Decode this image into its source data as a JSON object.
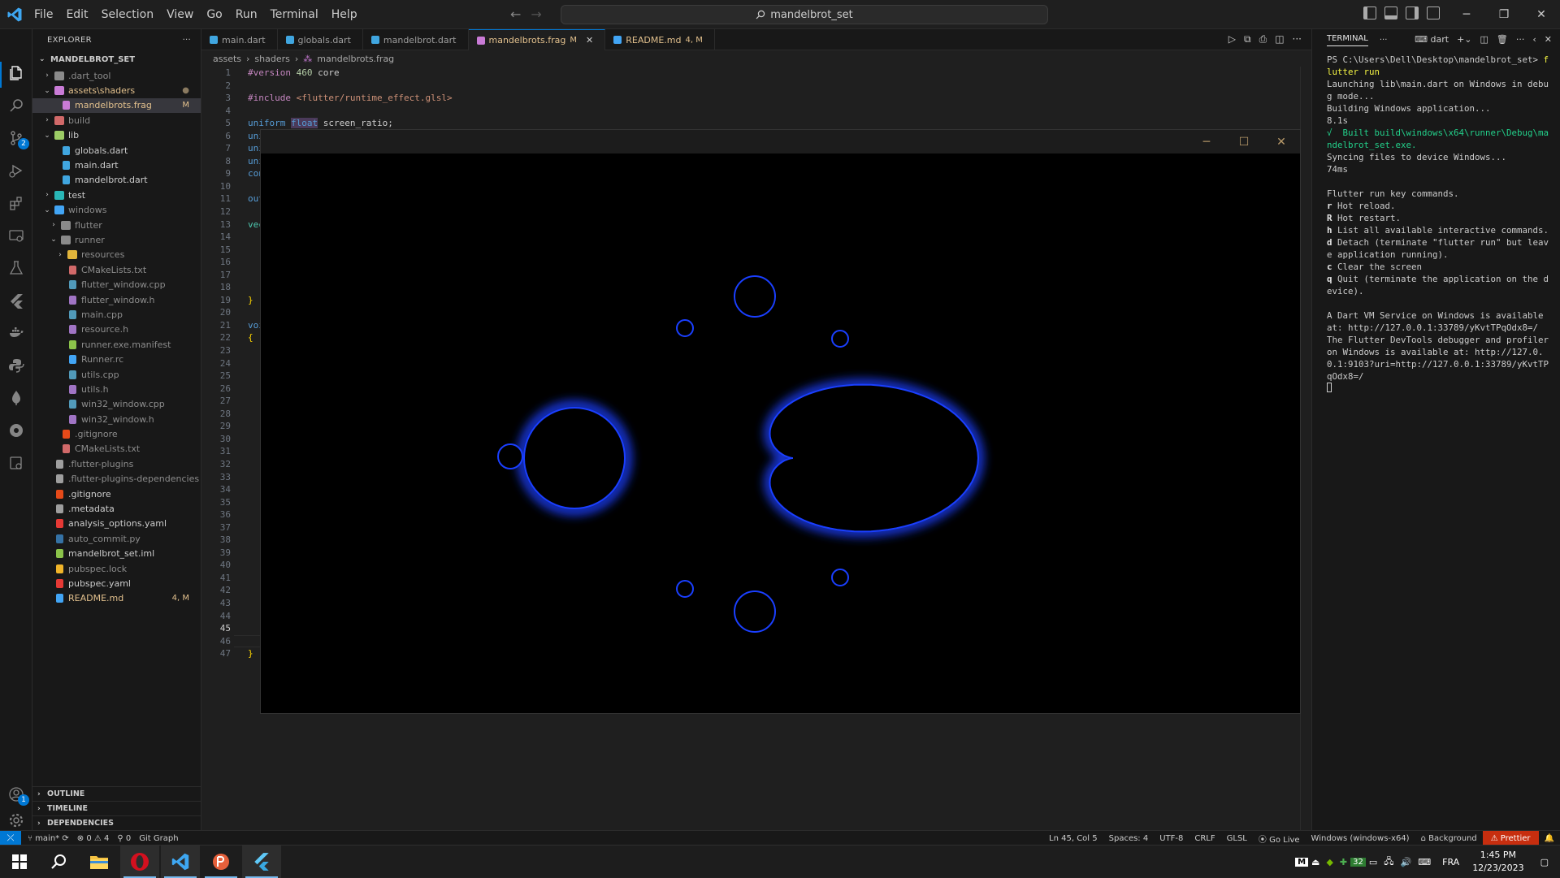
{
  "titlebar": {
    "menu": [
      "File",
      "Edit",
      "Selection",
      "View",
      "Go",
      "Run",
      "Terminal",
      "Help"
    ],
    "search": "mandelbrot_set"
  },
  "explorer": {
    "header": "EXPLORER",
    "root": "MANDELBROT_SET",
    "tree": [
      {
        "indent": 0,
        "chev": "›",
        "icon": "folder",
        "color": "#8a8a8a",
        "name": ".dart_tool",
        "status": "",
        "nameColor": "#8c8c8c"
      },
      {
        "indent": 0,
        "chev": "⌄",
        "icon": "folder",
        "color": "#c97bd6",
        "name": "assets\\shaders",
        "status": "●",
        "nameColor": "#e2c08d"
      },
      {
        "indent": 1,
        "chev": "",
        "icon": "shader",
        "color": "#c97bd6",
        "name": "mandelbrots.frag",
        "status": "M",
        "nameColor": "#e2c08d",
        "selected": true
      },
      {
        "indent": 0,
        "chev": "›",
        "icon": "folder",
        "color": "#d16969",
        "name": "build",
        "status": "",
        "nameColor": "#8c8c8c"
      },
      {
        "indent": 0,
        "chev": "⌄",
        "icon": "folder",
        "color": "#9ccc65",
        "name": "lib",
        "status": "",
        "nameColor": "#cccccc"
      },
      {
        "indent": 1,
        "chev": "",
        "icon": "dart",
        "color": "#40a6e0",
        "name": "globals.dart",
        "status": "",
        "nameColor": "#cccccc"
      },
      {
        "indent": 1,
        "chev": "",
        "icon": "dart",
        "color": "#40a6e0",
        "name": "main.dart",
        "status": "",
        "nameColor": "#cccccc"
      },
      {
        "indent": 1,
        "chev": "",
        "icon": "dart",
        "color": "#40a6e0",
        "name": "mandelbrot.dart",
        "status": "",
        "nameColor": "#cccccc"
      },
      {
        "indent": 0,
        "chev": "›",
        "icon": "folder",
        "color": "#29b6b6",
        "name": "test",
        "status": "",
        "nameColor": "#cccccc"
      },
      {
        "indent": 0,
        "chev": "⌄",
        "icon": "folder",
        "color": "#42a5f5",
        "name": "windows",
        "status": "",
        "nameColor": "#8c8c8c"
      },
      {
        "indent": 1,
        "chev": "›",
        "icon": "folder",
        "color": "#8a8a8a",
        "name": "flutter",
        "status": "",
        "nameColor": "#8c8c8c"
      },
      {
        "indent": 1,
        "chev": "⌄",
        "icon": "folder",
        "color": "#8a8a8a",
        "name": "runner",
        "status": "",
        "nameColor": "#8c8c8c"
      },
      {
        "indent": 2,
        "chev": "›",
        "icon": "folder",
        "color": "#e2b53b",
        "name": "resources",
        "status": "",
        "nameColor": "#8c8c8c"
      },
      {
        "indent": 2,
        "chev": "",
        "icon": "cmake",
        "color": "#d16969",
        "name": "CMakeLists.txt",
        "status": "",
        "nameColor": "#8c8c8c"
      },
      {
        "indent": 2,
        "chev": "",
        "icon": "cpp",
        "color": "#519aba",
        "name": "flutter_window.cpp",
        "status": "",
        "nameColor": "#8c8c8c"
      },
      {
        "indent": 2,
        "chev": "",
        "icon": "h",
        "color": "#a074c4",
        "name": "flutter_window.h",
        "status": "",
        "nameColor": "#8c8c8c"
      },
      {
        "indent": 2,
        "chev": "",
        "icon": "cpp",
        "color": "#519aba",
        "name": "main.cpp",
        "status": "",
        "nameColor": "#8c8c8c"
      },
      {
        "indent": 2,
        "chev": "",
        "icon": "h",
        "color": "#a074c4",
        "name": "resource.h",
        "status": "",
        "nameColor": "#8c8c8c"
      },
      {
        "indent": 2,
        "chev": "",
        "icon": "manifest",
        "color": "#8bc34a",
        "name": "runner.exe.manifest",
        "status": "",
        "nameColor": "#8c8c8c"
      },
      {
        "indent": 2,
        "chev": "",
        "icon": "rc",
        "color": "#42a5f5",
        "name": "Runner.rc",
        "status": "",
        "nameColor": "#8c8c8c"
      },
      {
        "indent": 2,
        "chev": "",
        "icon": "cpp",
        "color": "#519aba",
        "name": "utils.cpp",
        "status": "",
        "nameColor": "#8c8c8c"
      },
      {
        "indent": 2,
        "chev": "",
        "icon": "h",
        "color": "#a074c4",
        "name": "utils.h",
        "status": "",
        "nameColor": "#8c8c8c"
      },
      {
        "indent": 2,
        "chev": "",
        "icon": "cpp",
        "color": "#519aba",
        "name": "win32_window.cpp",
        "status": "",
        "nameColor": "#8c8c8c"
      },
      {
        "indent": 2,
        "chev": "",
        "icon": "h",
        "color": "#a074c4",
        "name": "win32_window.h",
        "status": "",
        "nameColor": "#8c8c8c"
      },
      {
        "indent": 1,
        "chev": "",
        "icon": "git",
        "color": "#e64a19",
        "name": ".gitignore",
        "status": "",
        "nameColor": "#8c8c8c"
      },
      {
        "indent": 1,
        "chev": "",
        "icon": "cmake",
        "color": "#d16969",
        "name": "CMakeLists.txt",
        "status": "",
        "nameColor": "#8c8c8c"
      },
      {
        "indent": 0,
        "chev": "",
        "icon": "file",
        "color": "#9e9e9e",
        "name": ".flutter-plugins",
        "status": "",
        "nameColor": "#8c8c8c"
      },
      {
        "indent": 0,
        "chev": "",
        "icon": "file",
        "color": "#9e9e9e",
        "name": ".flutter-plugins-dependencies",
        "status": "",
        "nameColor": "#8c8c8c"
      },
      {
        "indent": 0,
        "chev": "",
        "icon": "git",
        "color": "#e64a19",
        "name": ".gitignore",
        "status": "",
        "nameColor": "#cccccc"
      },
      {
        "indent": 0,
        "chev": "",
        "icon": "file",
        "color": "#9e9e9e",
        "name": ".metadata",
        "status": "",
        "nameColor": "#cccccc"
      },
      {
        "indent": 0,
        "chev": "",
        "icon": "yaml",
        "color": "#e53935",
        "name": "analysis_options.yaml",
        "status": "",
        "nameColor": "#cccccc"
      },
      {
        "indent": 0,
        "chev": "",
        "icon": "py",
        "color": "#3572a5",
        "name": "auto_commit.py",
        "status": "",
        "nameColor": "#8c8c8c"
      },
      {
        "indent": 0,
        "chev": "",
        "icon": "iml",
        "color": "#8bc34a",
        "name": "mandelbrot_set.iml",
        "status": "",
        "nameColor": "#cccccc"
      },
      {
        "indent": 0,
        "chev": "",
        "icon": "lock",
        "color": "#f0b429",
        "name": "pubspec.lock",
        "status": "",
        "nameColor": "#8c8c8c"
      },
      {
        "indent": 0,
        "chev": "",
        "icon": "yaml",
        "color": "#e53935",
        "name": "pubspec.yaml",
        "status": "",
        "nameColor": "#cccccc"
      },
      {
        "indent": 0,
        "chev": "",
        "icon": "info",
        "color": "#42a5f5",
        "name": "README.md",
        "status": "4, M",
        "nameColor": "#e2c08d"
      }
    ],
    "sections": [
      "OUTLINE",
      "TIMELINE",
      "DEPENDENCIES"
    ]
  },
  "tabs": [
    {
      "label": "main.dart",
      "icon": "#40a6e0",
      "suffix": "",
      "active": false
    },
    {
      "label": "globals.dart",
      "icon": "#40a6e0",
      "suffix": "",
      "active": false
    },
    {
      "label": "mandelbrot.dart",
      "icon": "#40a6e0",
      "suffix": "",
      "active": false
    },
    {
      "label": "mandelbrots.frag",
      "icon": "#c97bd6",
      "suffix": "M",
      "active": true
    },
    {
      "label": "README.md",
      "icon": "#42a5f5",
      "suffix": "4, M",
      "active": false
    }
  ],
  "breadcrumb": [
    "assets",
    "shaders",
    "mandelbrots.frag"
  ],
  "code": {
    "line_numbers": [
      "1",
      "2",
      "3",
      "4",
      "5",
      "6",
      "7",
      "8",
      "9",
      "10",
      "11",
      "12",
      "13",
      "14",
      "15",
      "16",
      "17",
      "18",
      "19",
      "20",
      "21",
      "22",
      "23",
      "24",
      "25",
      "26",
      "27",
      "28",
      "29",
      "30",
      "31",
      "32",
      "33",
      "34",
      "35",
      "36",
      "37",
      "38",
      "39",
      "40",
      "41",
      "42",
      "43",
      "44",
      "45",
      "46",
      "47"
    ],
    "current_line": "45",
    "l1_kw": "#version",
    "l1_num": "460",
    "l1_rest": " core",
    "l3_kw": "#include",
    "l3_str": " <flutter/runtime_effect.glsl>",
    "l5_kw": "uniform",
    "l5_ty": "float",
    "l5_rest": " screen_ratio;",
    "l6": "uni",
    "l7": "uni",
    "l8": "uni",
    "l9": "con",
    "l11": "out",
    "l13": "vec",
    "l19": "}",
    "l21": "voi",
    "l22": "{",
    "l47": "}"
  },
  "app_window": {
    "fractal_color": "#1a3fff"
  },
  "terminal": {
    "title": "TERMINAL",
    "shell": "dart",
    "prompt": "PS C:\\Users\\Dell\\Desktop\\mandelbrot_set> ",
    "command": "flutter run",
    "lines": [
      "Launching lib\\main.dart on Windows in debug mode...",
      "Building Windows application...                        8.1s"
    ],
    "built_check": "√  Built ",
    "built_path": "build\\windows\\x64\\runner\\Debug\\mandelbrot_set.exe.",
    "sync": "Syncing files to device Windows...                     74ms",
    "keys_title": "Flutter run key commands.",
    "keys": [
      {
        "k": "r",
        "d": " Hot reload."
      },
      {
        "k": "R",
        "d": " Hot restart."
      },
      {
        "k": "h",
        "d": " List all available interactive commands."
      },
      {
        "k": "d",
        "d": " Detach (terminate \"flutter run\" but leave application running)."
      },
      {
        "k": "c",
        "d": " Clear the screen"
      },
      {
        "k": "q",
        "d": " Quit (terminate the application on the device)."
      }
    ],
    "vm": "A Dart VM Service on Windows is available at: http://127.0.0.1:33789/yKvtTPqOdx8=/",
    "devtools": "The Flutter DevTools debugger and profiler on Windows is available at: http://127.0.0.1:9103?uri=http://127.0.0.1:33789/yKvtTPqOdx8=/"
  },
  "statusbar": {
    "branch": "main*",
    "errors": "0",
    "warnings": "4",
    "ports": "0",
    "git_graph": "Git Graph",
    "cursor": "Ln 45, Col 5",
    "spaces": "Spaces: 4",
    "encoding": "UTF-8",
    "eol": "CRLF",
    "language": "GLSL",
    "golive": "Go Live",
    "device": "Windows (windows-x64)",
    "background": "Background",
    "prettier": "Prettier"
  },
  "taskbar": {
    "lang": "FRA",
    "time": "1:45 PM",
    "date": "12/23/2023",
    "tray_badge": "32"
  }
}
